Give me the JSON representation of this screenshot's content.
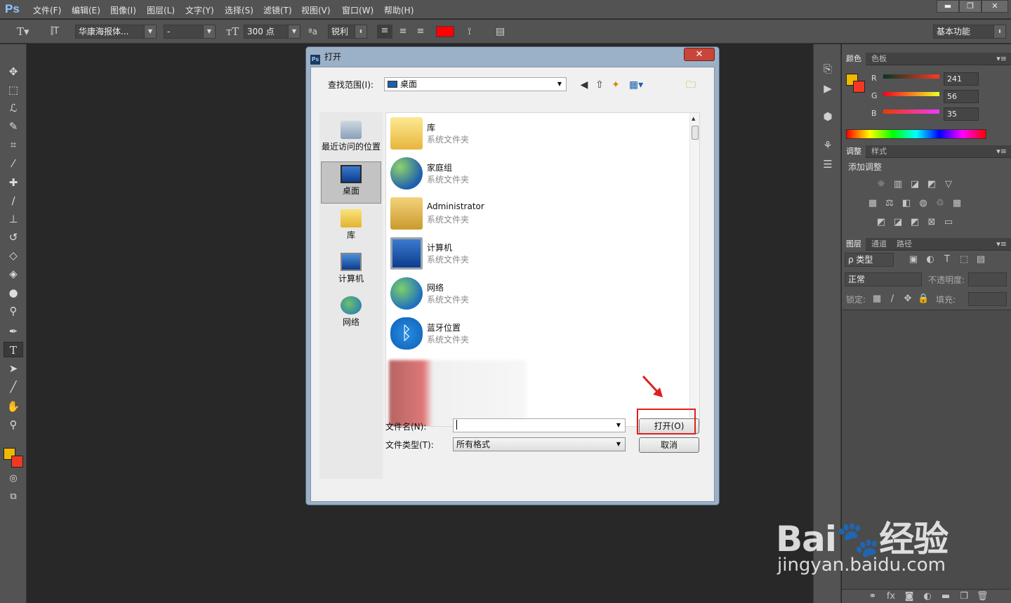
{
  "app": {
    "logo": "Ps",
    "menu": [
      "文件(F)",
      "编辑(E)",
      "图像(I)",
      "图层(L)",
      "文字(Y)",
      "选择(S)",
      "滤镜(T)",
      "视图(V)",
      "窗口(W)",
      "帮助(H)"
    ],
    "window_buttons": [
      "▬",
      "❐",
      "✕"
    ]
  },
  "options": {
    "font_family": "华康海报体...",
    "font_style": "-",
    "font_size": "300 点",
    "antialias_icon_text": "ªa",
    "antialias": "锐利",
    "text_color": "#ff0000",
    "workspace": "基本功能"
  },
  "toolbar": {
    "foreground_color": "#f1b800",
    "background_color": "#f13823"
  },
  "panels": {
    "color_tabs": [
      "颜色",
      "色板"
    ],
    "r_label": "R",
    "r_value": "241",
    "g_label": "G",
    "g_value": "56",
    "b_label": "B",
    "b_value": "35",
    "adjust_tabs": [
      "调整",
      "样式"
    ],
    "adjust_title": "添加调整",
    "layer_tabs": [
      "图层",
      "通道",
      "路径"
    ],
    "layer_filter": "ρ 类型",
    "blend_mode": "正常",
    "opacity_label": "不透明度:",
    "lock_label": "锁定:",
    "fill_label": "填充:"
  },
  "dialog": {
    "title": "打开",
    "title_icon": "Ps",
    "close": "✕",
    "look_in_label": "查找范围(I):",
    "look_in_value": "桌面",
    "places": [
      "最近访问的位置",
      "桌面",
      "库",
      "计算机",
      "网络"
    ],
    "files": [
      {
        "name": "库",
        "type": "系统文件夹"
      },
      {
        "name": "家庭组",
        "type": "系统文件夹"
      },
      {
        "name": "Administrator",
        "type": "系统文件夹"
      },
      {
        "name": "计算机",
        "type": "系统文件夹"
      },
      {
        "name": "网络",
        "type": "系统文件夹"
      },
      {
        "name": "蓝牙位置",
        "type": "系统文件夹"
      }
    ],
    "filename_label": "文件名(N):",
    "filename_value": "",
    "filetype_label": "文件类型(T):",
    "filetype_value": "所有格式",
    "open_button": "打开(O)",
    "cancel_button": "取消"
  },
  "watermark": {
    "logo": "Bai🐾经验",
    "url": "jingyan.baidu.com"
  }
}
